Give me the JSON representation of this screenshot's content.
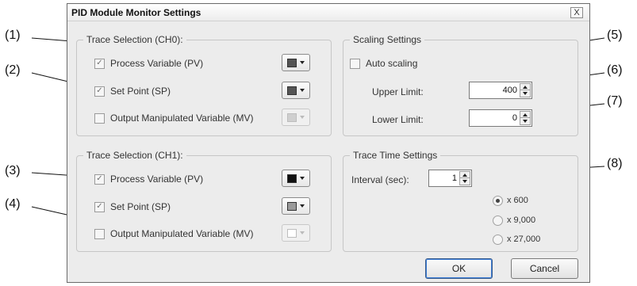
{
  "dialog": {
    "title": "PID Module Monitor Settings",
    "close_label": "X"
  },
  "trace_ch0": {
    "title": "Trace Selection (CH0):",
    "pv": {
      "label": "Process Variable (PV)",
      "checked": true,
      "color": "#555555"
    },
    "sp": {
      "label": "Set Point (SP)",
      "checked": true,
      "color": "#555555"
    },
    "mv": {
      "label": "Output Manipulated Variable (MV)",
      "checked": false,
      "color": "#cfcfcf"
    }
  },
  "trace_ch1": {
    "title": "Trace Selection (CH1):",
    "pv": {
      "label": "Process Variable (PV)",
      "checked": true,
      "color": "#111111"
    },
    "sp": {
      "label": "Set Point (SP)",
      "checked": true,
      "color": "#9a9a9a"
    },
    "mv": {
      "label": "Output Manipulated Variable (MV)",
      "checked": false,
      "color": "#ffffff"
    }
  },
  "scaling": {
    "title": "Scaling Settings",
    "auto_label": "Auto scaling",
    "auto_checked": false,
    "upper_label": "Upper Limit:",
    "upper_value": "400",
    "lower_label": "Lower Limit:",
    "lower_value": "0"
  },
  "trace_time": {
    "title": "Trace Time Settings",
    "interval_label": "Interval (sec):",
    "interval_value": "1",
    "options": [
      {
        "label": "x 600",
        "selected": true
      },
      {
        "label": "x 9,000",
        "selected": false
      },
      {
        "label": "x 27,000",
        "selected": false
      }
    ]
  },
  "buttons": {
    "ok": "OK",
    "cancel": "Cancel"
  },
  "callouts": [
    "(1)",
    "(2)",
    "(3)",
    "(4)",
    "(5)",
    "(6)",
    "(7)",
    "(8)"
  ]
}
